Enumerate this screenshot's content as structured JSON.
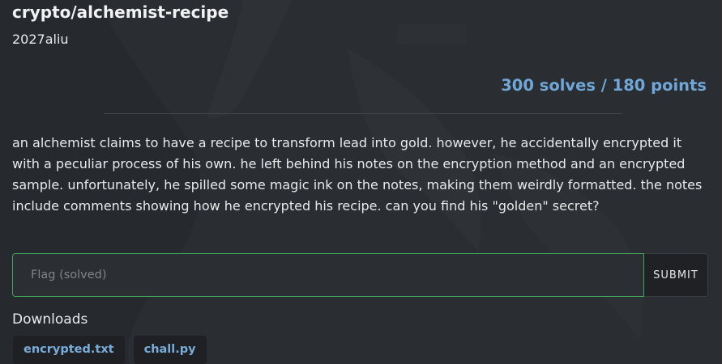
{
  "challenge": {
    "title": "crypto/alchemist-recipe",
    "author": "2027aliu",
    "stats": "300 solves / 180 points",
    "description": "an alchemist claims to have a recipe to transform lead into gold. however, he accidentally encrypted it with a peculiar process of his own. he left behind his notes on the encryption method and an encrypted sample. unfortunately, he spilled some magic ink on the notes, making them weirdly formatted. the notes include comments showing how he encrypted his recipe. can you find his \"golden\" secret?"
  },
  "flag_form": {
    "placeholder": "Flag (solved)",
    "value": "",
    "submit_label": "SUBMIT"
  },
  "downloads": {
    "label": "Downloads",
    "files": [
      "encrypted.txt",
      "chall.py"
    ]
  },
  "colors": {
    "background": "#2a2d31",
    "accent_link": "#6fa7d8",
    "solved_border": "#3ea55c"
  }
}
